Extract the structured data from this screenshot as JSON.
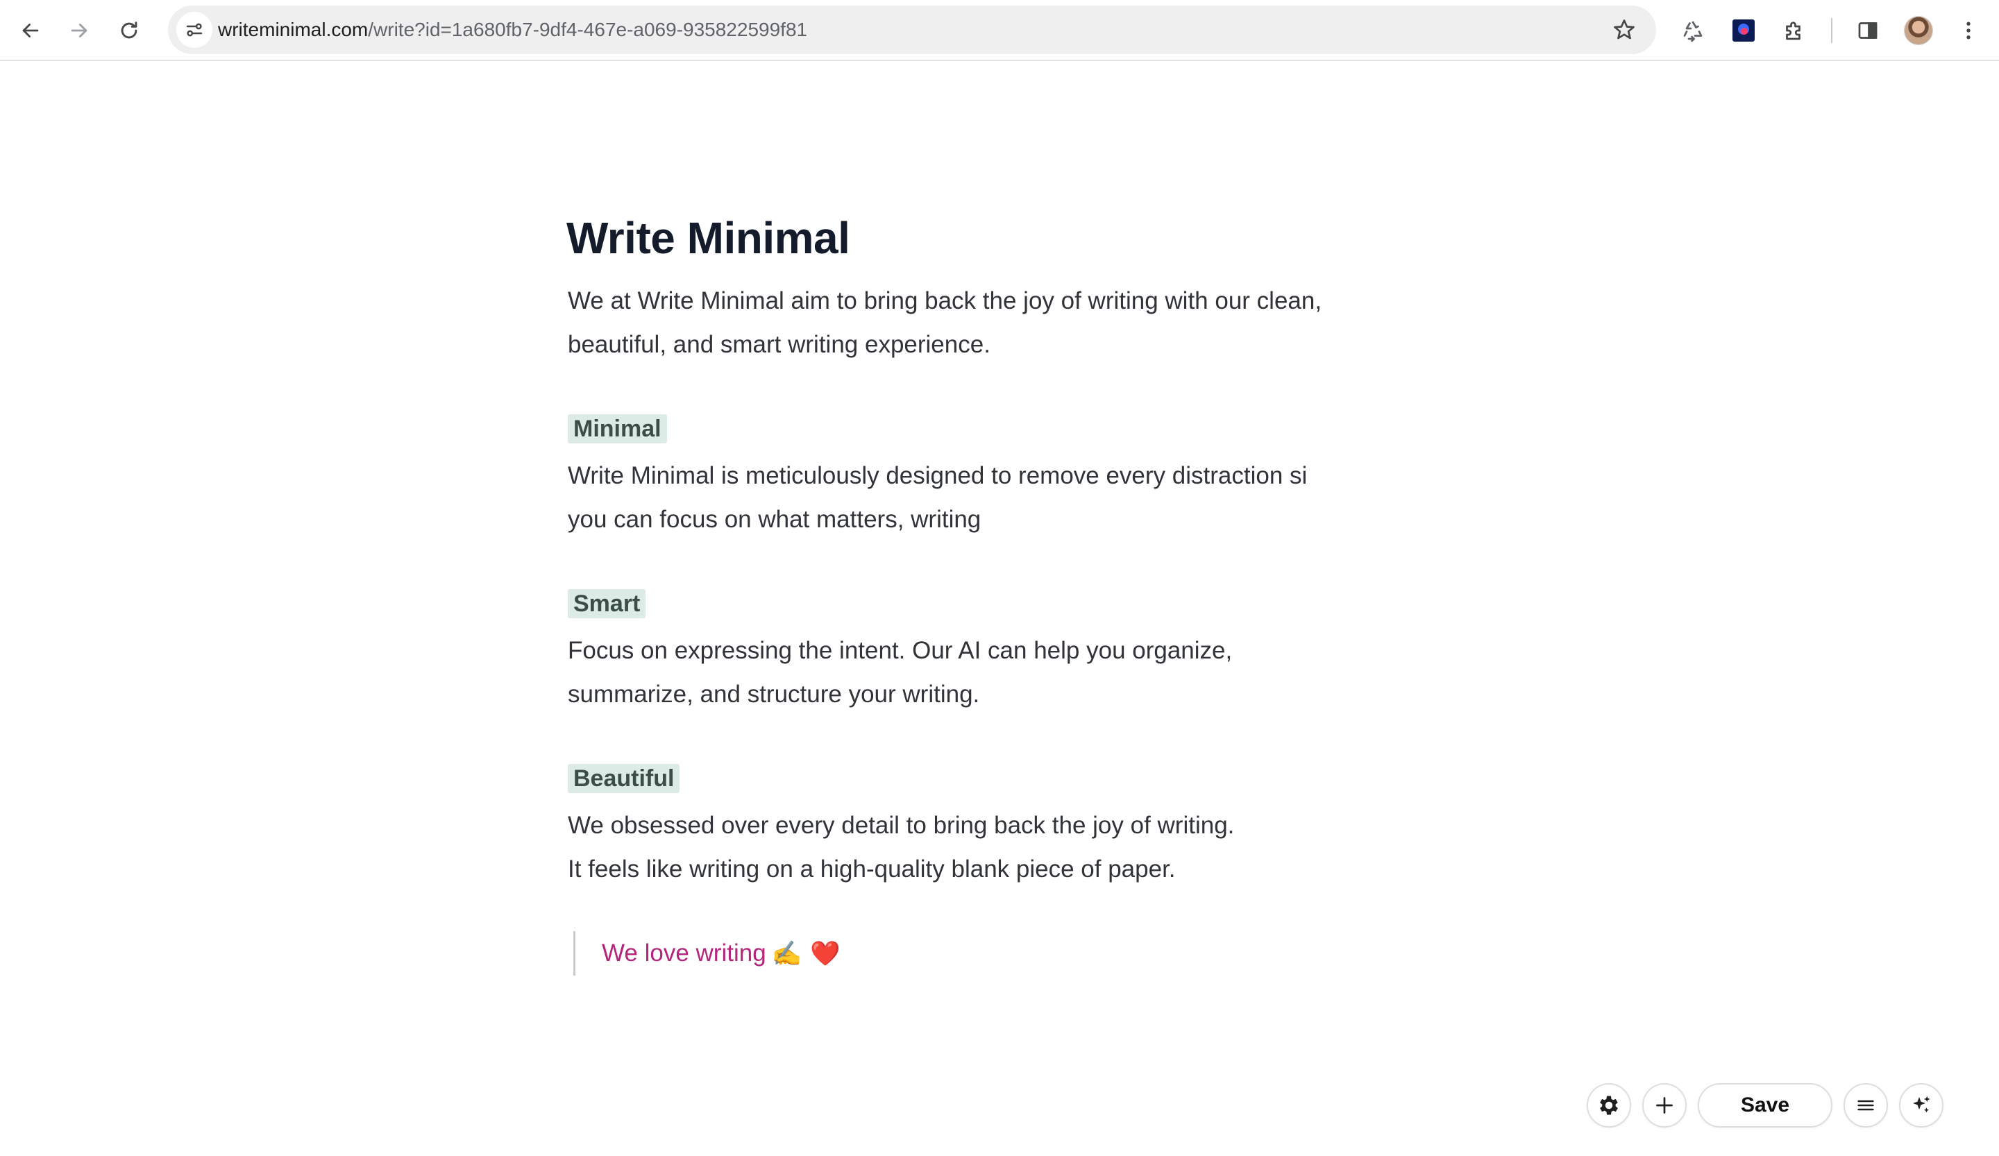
{
  "browser": {
    "url_host": "writeminimal.com",
    "url_path": "/write?id=1a680fb7-9df4-467e-a069-935822599f81",
    "icons": {
      "back": "arrow-left-icon",
      "forward": "arrow-right-icon",
      "reload": "reload-icon",
      "site_info": "tune-icon",
      "bookmark": "star-icon",
      "recycle": "recycle-icon",
      "extension_tile": "extension-app-icon",
      "extensions": "puzzle-icon",
      "side_panel": "side-panel-icon",
      "profile": "avatar",
      "menu": "kebab-menu-icon"
    }
  },
  "document": {
    "title": "Write Minimal",
    "intro": [
      "We at Write Minimal aim to bring back the joy of writing with our clean,",
      "beautiful, and smart writing experience."
    ],
    "sections": [
      {
        "heading": "Minimal",
        "lines": [
          "Write Minimal is meticulously designed to remove every distraction si",
          "you can focus on what matters, writing"
        ]
      },
      {
        "heading": "Smart",
        "lines": [
          "Focus on expressing the intent. Our AI can help you organize,",
          "summarize, and structure your writing."
        ]
      },
      {
        "heading": "Beautiful",
        "lines": [
          "We obsessed over every detail to bring back the joy of writing.",
          "It feels like writing on a high-quality blank piece of paper."
        ]
      }
    ],
    "quote": {
      "text": "We love writing",
      "emoji_1": "✍️",
      "emoji_2": "❤️"
    }
  },
  "controls": {
    "save_label": "Save",
    "icons": {
      "settings": "gear-icon",
      "add": "plus-icon",
      "menu": "hamburger-menu-icon",
      "ai": "sparkle-icon"
    }
  },
  "colors": {
    "title": "#141b2b",
    "body_text": "#303338",
    "heading_highlight_bg": "#dcebe5",
    "heading_text": "#3b4d48",
    "quote_text": "#b5257c",
    "quote_border": "#c9c9c9"
  }
}
